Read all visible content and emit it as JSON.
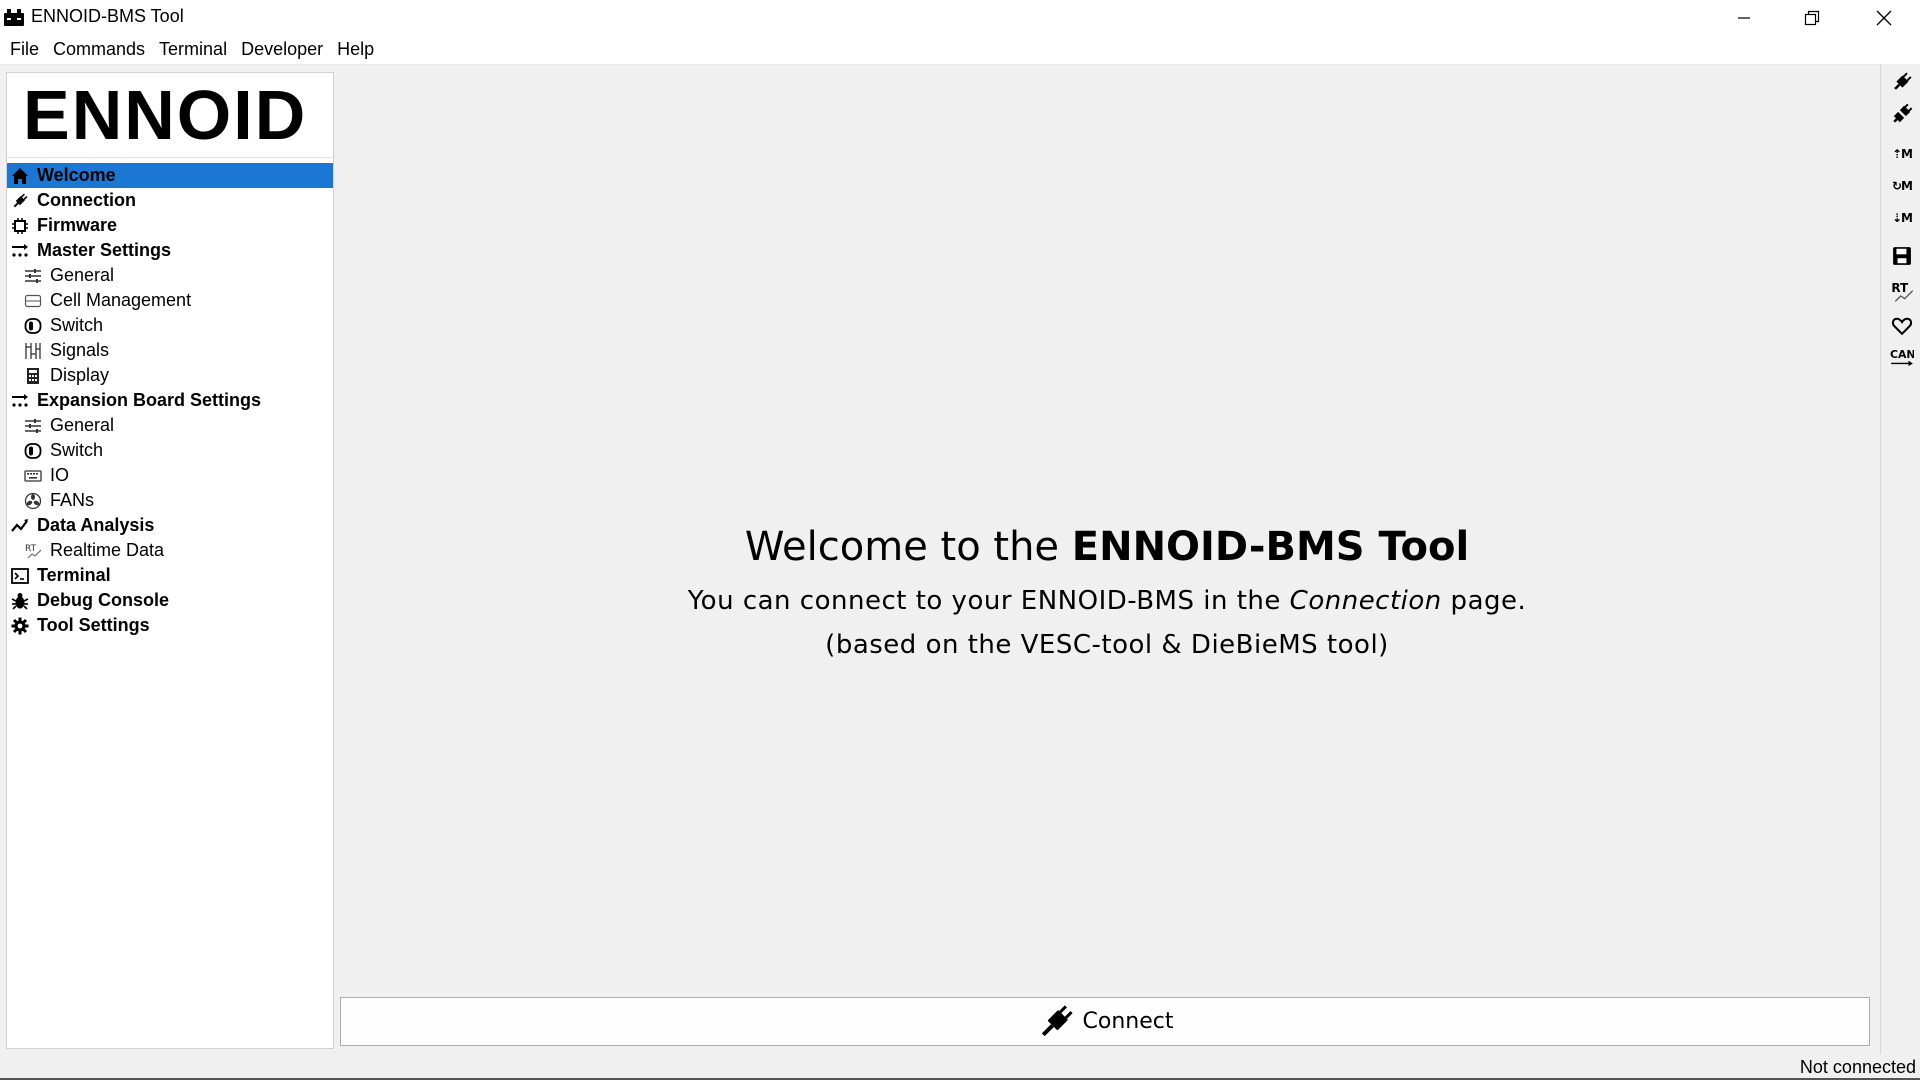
{
  "window": {
    "title": "ENNOID-BMS Tool"
  },
  "menu": [
    "File",
    "Commands",
    "Terminal",
    "Developer",
    "Help"
  ],
  "logo": {
    "text": "ENNOID"
  },
  "sidebar": {
    "selected_color": "#1a78d4",
    "items": [
      {
        "label": "Welcome",
        "icon": "home-icon",
        "level": 0,
        "selected": true
      },
      {
        "label": "Connection",
        "icon": "plug-icon",
        "level": 0
      },
      {
        "label": "Firmware",
        "icon": "chip-icon",
        "level": 0
      },
      {
        "label": "Master Settings",
        "icon": "settings-arrows-icon",
        "level": 0
      },
      {
        "label": "General",
        "icon": "sliders-icon",
        "level": 1
      },
      {
        "label": "Cell Management",
        "icon": "cells-icon",
        "level": 1
      },
      {
        "label": "Switch",
        "icon": "switch-icon",
        "level": 1
      },
      {
        "label": "Signals",
        "icon": "signals-icon",
        "level": 1
      },
      {
        "label": "Display",
        "icon": "calculator-icon",
        "level": 1
      },
      {
        "label": "Expansion Board Settings",
        "icon": "settings-arrows-icon",
        "level": 0
      },
      {
        "label": "General",
        "icon": "sliders-icon",
        "level": 1
      },
      {
        "label": "Switch",
        "icon": "switch-icon",
        "level": 1
      },
      {
        "label": "IO",
        "icon": "keyboard-icon",
        "level": 1
      },
      {
        "label": "FANs",
        "icon": "fan-icon",
        "level": 1
      },
      {
        "label": "Data Analysis",
        "icon": "chart-line-icon",
        "level": 0
      },
      {
        "label": "Realtime Data",
        "icon": "realtime-icon",
        "level": 1
      },
      {
        "label": "Terminal",
        "icon": "terminal-icon",
        "level": 0
      },
      {
        "label": "Debug Console",
        "icon": "bug-icon",
        "level": 0
      },
      {
        "label": "Tool Settings",
        "icon": "gear-icon",
        "level": 0
      }
    ]
  },
  "welcome": {
    "title_prefix": "Welcome to the ",
    "title_bold": "ENNOID-BMS Tool",
    "line2_prefix": "You can connect to your ENNOID-BMS in the ",
    "line2_italic": "Connection",
    "line2_suffix": " page.",
    "line3": "(based on the VESC-tool & DieBieMS tool)"
  },
  "connect_button": {
    "label": "Connect",
    "icon": "plug-icon"
  },
  "right_toolbar": [
    {
      "icon": "plug-icon"
    },
    {
      "icon": "unplug-icon"
    },
    {
      "icon": "read-config-icon",
      "text": "⇡M"
    },
    {
      "icon": "reload-config-icon",
      "text": "↻M"
    },
    {
      "icon": "write-config-icon",
      "text": "⇣M"
    },
    {
      "icon": "save-icon"
    },
    {
      "icon": "realtime-icon",
      "text": "RT"
    },
    {
      "icon": "heart-icon"
    },
    {
      "icon": "can-icon",
      "text": "CAN"
    }
  ],
  "status": {
    "text": "Not connected"
  }
}
